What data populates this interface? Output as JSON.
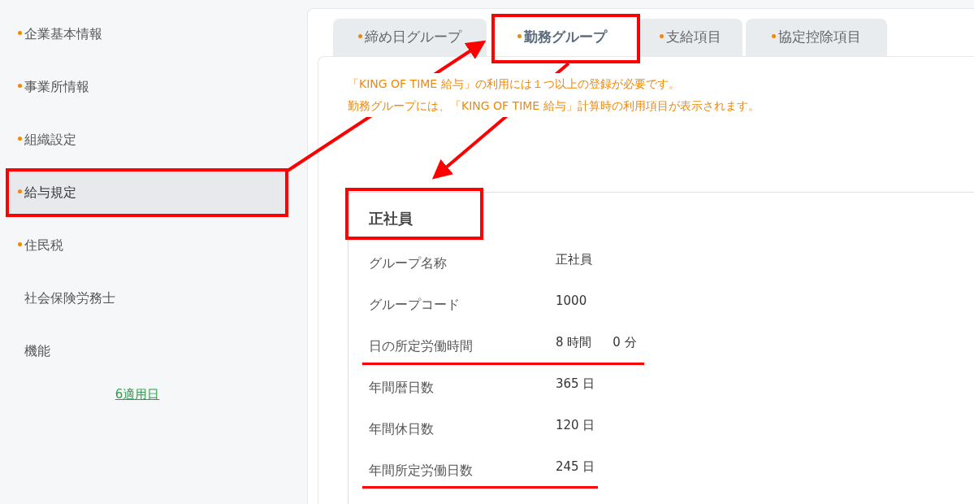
{
  "sidebar": {
    "items": [
      {
        "label": "企業基本情報",
        "dot": true,
        "selected": false
      },
      {
        "label": "事業所情報",
        "dot": true,
        "selected": false
      },
      {
        "label": "組織設定",
        "dot": true,
        "selected": false
      },
      {
        "label": "給与規定",
        "dot": true,
        "selected": true
      },
      {
        "label": "住民税",
        "dot": true,
        "selected": false
      },
      {
        "label": "社会保険労務士",
        "dot": false,
        "selected": false
      },
      {
        "label": "機能",
        "dot": false,
        "selected": false
      }
    ],
    "link": "6適用日"
  },
  "tabs": [
    {
      "label": "締め日グループ",
      "dot": true,
      "selected": false
    },
    {
      "label": "勤務グループ",
      "dot": true,
      "selected": true
    },
    {
      "label": "支給項目",
      "dot": true,
      "selected": false
    },
    {
      "label": "協定控除項目",
      "dot": true,
      "selected": false
    }
  ],
  "notice": [
    "「KING OF TIME 給与」の利用には１つ以上の登録が必要です。",
    "勤務グループには、「KING OF TIME 給与」計算時の利用項目が表示されます。"
  ],
  "group": {
    "title": "正社員",
    "rows": [
      {
        "label": "グループ名称",
        "values": [
          "正社員"
        ]
      },
      {
        "label": "グループコード",
        "values": [
          "1000"
        ]
      },
      {
        "label": "日の所定労働時間",
        "values": [
          "8 時間",
          "0 分"
        ]
      },
      {
        "label": "年間暦日数",
        "values": [
          "365 日"
        ]
      },
      {
        "label": "年間休日数",
        "values": [
          "120 日"
        ]
      },
      {
        "label": "年間所定労働日数",
        "values": [
          "245 日"
        ]
      }
    ]
  }
}
